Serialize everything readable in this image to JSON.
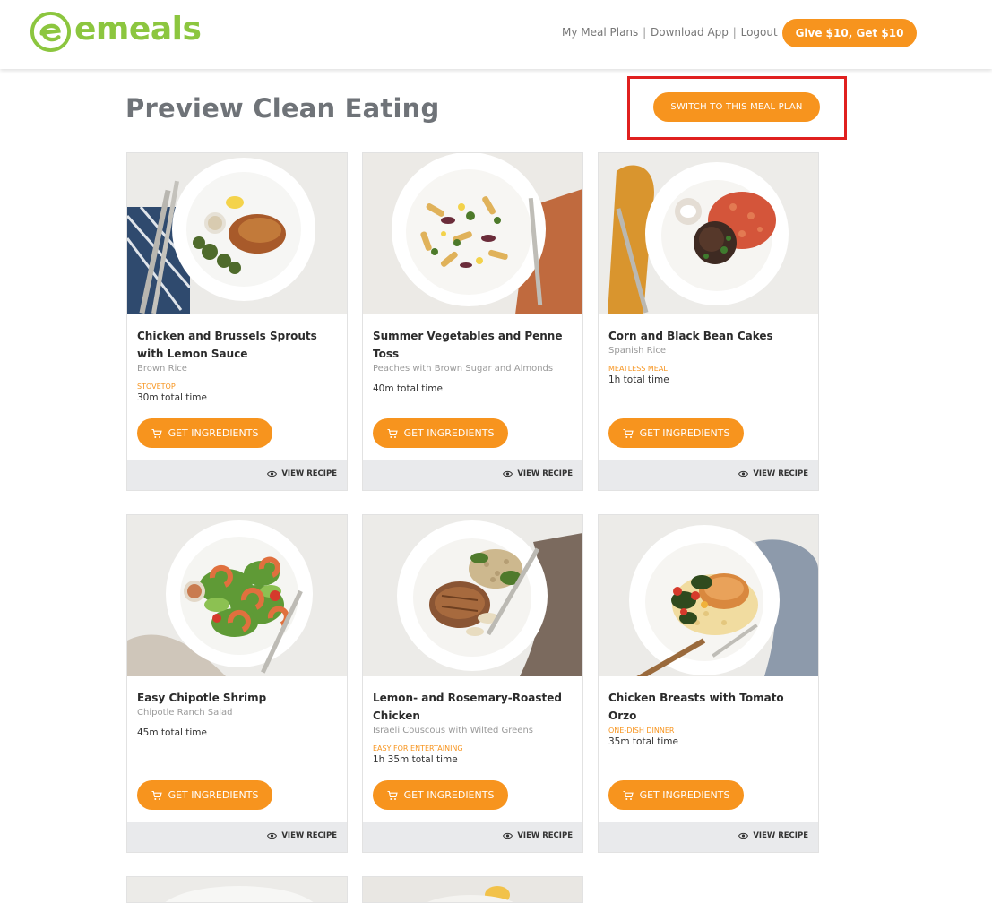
{
  "header": {
    "logo_text": "emeals",
    "nav": {
      "my_meal_plans": "My Meal Plans",
      "download_app": "Download App",
      "logout": "Logout",
      "separator": "|"
    },
    "give_button": "Give $10, Get $10"
  },
  "page": {
    "title": "Preview Clean Eating",
    "switch_button": "SWITCH TO THIS MEAL PLAN"
  },
  "labels": {
    "get_ingredients": "GET INGREDIENTS",
    "view_recipe": "VIEW RECIPE"
  },
  "recipes": [
    {
      "title": "Chicken and Brussels Sprouts with Lemon Sauce",
      "side": "Brown Rice",
      "tag": "STOVETOP",
      "time": "30m total time"
    },
    {
      "title": "Summer Vegetables and Penne Toss",
      "side": "Peaches with Brown Sugar and Almonds",
      "tag": "",
      "time": "40m total time"
    },
    {
      "title": "Corn and Black Bean Cakes",
      "side": "Spanish Rice",
      "tag": "MEATLESS MEAL",
      "time": "1h total time"
    },
    {
      "title": "Easy Chipotle Shrimp",
      "side": "Chipotle Ranch Salad",
      "tag": "",
      "time": "45m total time"
    },
    {
      "title": "Lemon- and Rosemary-Roasted Chicken",
      "side": "Israeli Couscous with Wilted Greens",
      "tag": "EASY FOR ENTERTAINING",
      "time": "1h 35m total time"
    },
    {
      "title": "Chicken Breasts with Tomato Orzo",
      "side": "",
      "tag": "ONE-DISH DINNER",
      "time": "35m total time"
    }
  ],
  "colors": {
    "accent": "#f7941e",
    "brand_green": "#8cc63f",
    "highlight": "#e0201f",
    "footer_bg": "#e9eaec"
  }
}
